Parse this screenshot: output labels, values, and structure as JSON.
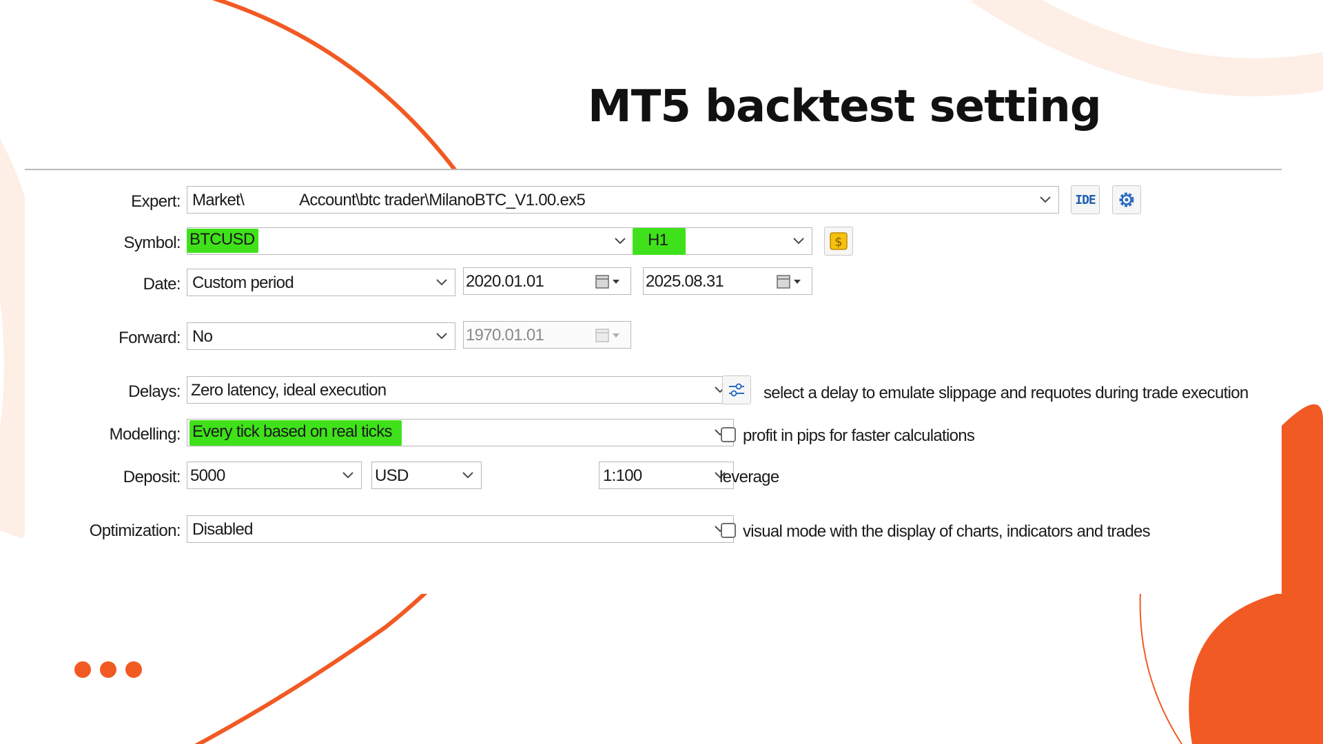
{
  "slide": {
    "title": "MT5 backtest setting"
  },
  "colors": {
    "accent": "#f25a23",
    "highlight": "#3fe21a",
    "peach": "#fdeee6"
  },
  "settings": {
    "expert": {
      "label": "Expert:",
      "value_start": "Market\\",
      "value_end": "Account\\btc trader\\MilanoBTC_V1.00.ex5"
    },
    "symbol": {
      "label": "Symbol:",
      "value": "BTCUSD",
      "timeframe": "H1"
    },
    "date": {
      "label": "Date:",
      "mode": "Custom period",
      "from": "2020.01.01",
      "to": "2025.08.31"
    },
    "forward": {
      "label": "Forward:",
      "value": "No",
      "date": "1970.01.01"
    },
    "delays": {
      "label": "Delays:",
      "value": "Zero latency, ideal execution",
      "hint": "select a delay to emulate slippage and requotes during trade execution"
    },
    "modelling": {
      "label": "Modelling:",
      "value": "Every tick based on real ticks",
      "checkbox_label": "profit in pips for faster calculations",
      "checked": false
    },
    "deposit": {
      "label": "Deposit:",
      "amount": "5000",
      "currency": "USD",
      "leverage": "1:100",
      "leverage_label": "leverage"
    },
    "optimization": {
      "label": "Optimization:",
      "value": "Disabled",
      "checkbox_label": "visual mode with the display of charts, indicators and trades",
      "checked": false
    },
    "buttons": {
      "ide": "IDE",
      "settings_icon": "gear-icon",
      "symbol_icon": "dollar-icon",
      "delay_icon": "sliders-icon"
    }
  }
}
